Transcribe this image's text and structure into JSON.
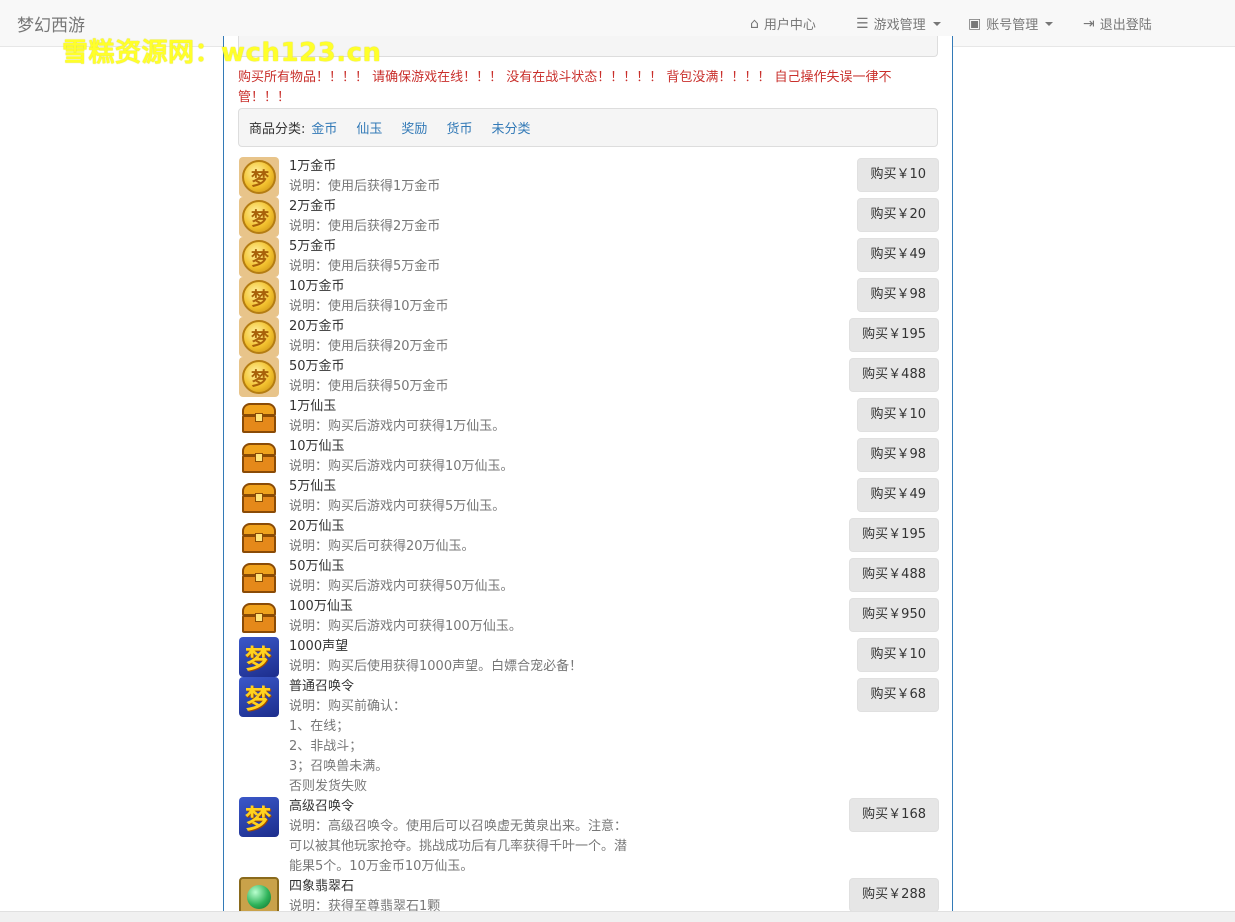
{
  "navbar": {
    "brand": "梦幻西游",
    "items": [
      {
        "label": "用户中心",
        "icon": "home-icon"
      },
      {
        "label": "游戏管理",
        "icon": "sliders-icon",
        "dropdown": true
      },
      {
        "label": "账号管理",
        "icon": "id-card-icon",
        "dropdown": true
      },
      {
        "label": "退出登陆",
        "icon": "logout-icon"
      }
    ]
  },
  "watermark": "雪糕资源网：wch123.cn",
  "warning": "购买所有物品！！！！ 请确保游戏在线！！！ 没有在战斗状态！！！！！ 背包没满！！！！ 自己操作失误一律不管！！！",
  "categories": {
    "label": "商品分类:",
    "links": [
      "金币",
      "仙玉",
      "奖励",
      "货币",
      "未分类"
    ]
  },
  "items": [
    {
      "icon": "gold-coin-icon",
      "name": "1万金币",
      "desc": "说明：使用后获得1万金币",
      "price": "购买￥10"
    },
    {
      "icon": "gold-coin-icon",
      "name": "2万金币",
      "desc": "说明：使用后获得2万金币",
      "price": "购买￥20"
    },
    {
      "icon": "gold-coin-icon",
      "name": "5万金币",
      "desc": "说明：使用后获得5万金币",
      "price": "购买￥49"
    },
    {
      "icon": "gold-coin-icon",
      "name": "10万金币",
      "desc": "说明：使用后获得10万金币",
      "price": "购买￥98"
    },
    {
      "icon": "gold-coin-icon",
      "name": "20万金币",
      "desc": "说明：使用后获得20万金币",
      "price": "购买￥195"
    },
    {
      "icon": "gold-coin-icon",
      "name": "50万金币",
      "desc": "说明：使用后获得50万金币",
      "price": "购买￥488"
    },
    {
      "icon": "treasure-chest-icon",
      "name": "1万仙玉",
      "desc": "说明：购买后游戏内可获得1万仙玉。",
      "price": "购买￥10"
    },
    {
      "icon": "treasure-chest-icon",
      "name": "10万仙玉",
      "desc": "说明：购买后游戏内可获得10万仙玉。",
      "price": "购买￥98"
    },
    {
      "icon": "treasure-chest-icon",
      "name": "5万仙玉",
      "desc": "说明：购买后游戏内可获得5万仙玉。",
      "price": "购买￥49"
    },
    {
      "icon": "treasure-chest-icon",
      "name": "20万仙玉",
      "desc": "说明：购买后可获得20万仙玉。",
      "price": "购买￥195"
    },
    {
      "icon": "treasure-chest-icon",
      "name": "50万仙玉",
      "desc": "说明：购买后游戏内可获得50万仙玉。",
      "price": "购买￥488"
    },
    {
      "icon": "treasure-chest-icon",
      "name": "100万仙玉",
      "desc": "说明：购买后游戏内可获得100万仙玉。",
      "price": "购买￥950"
    },
    {
      "icon": "meng-logo-icon",
      "name": "1000声望",
      "desc": "说明：购买后使用获得1000声望。白嫖合宠必备！",
      "price": "购买￥10"
    },
    {
      "icon": "meng-logo-icon",
      "name": "普通召唤令",
      "desc": "说明：购买前确认：\n1、在线；\n2、非战斗；\n3；召唤兽未满。\n否则发货失败",
      "price": "购买￥68"
    },
    {
      "icon": "meng-logo-icon",
      "name": "高级召唤令",
      "desc": "说明：高级召唤令。使用后可以召唤虚无黄泉出来。注意：可以被其他玩家抢夺。挑战成功后有几率获得千叶一个。潜能果5个。10万金币10万仙玉。",
      "price": "购买￥168"
    },
    {
      "icon": "green-gem-icon",
      "name": "四象翡翠石",
      "desc": "说明：获得至尊翡翠石1颗",
      "price": "购买￥288"
    }
  ]
}
